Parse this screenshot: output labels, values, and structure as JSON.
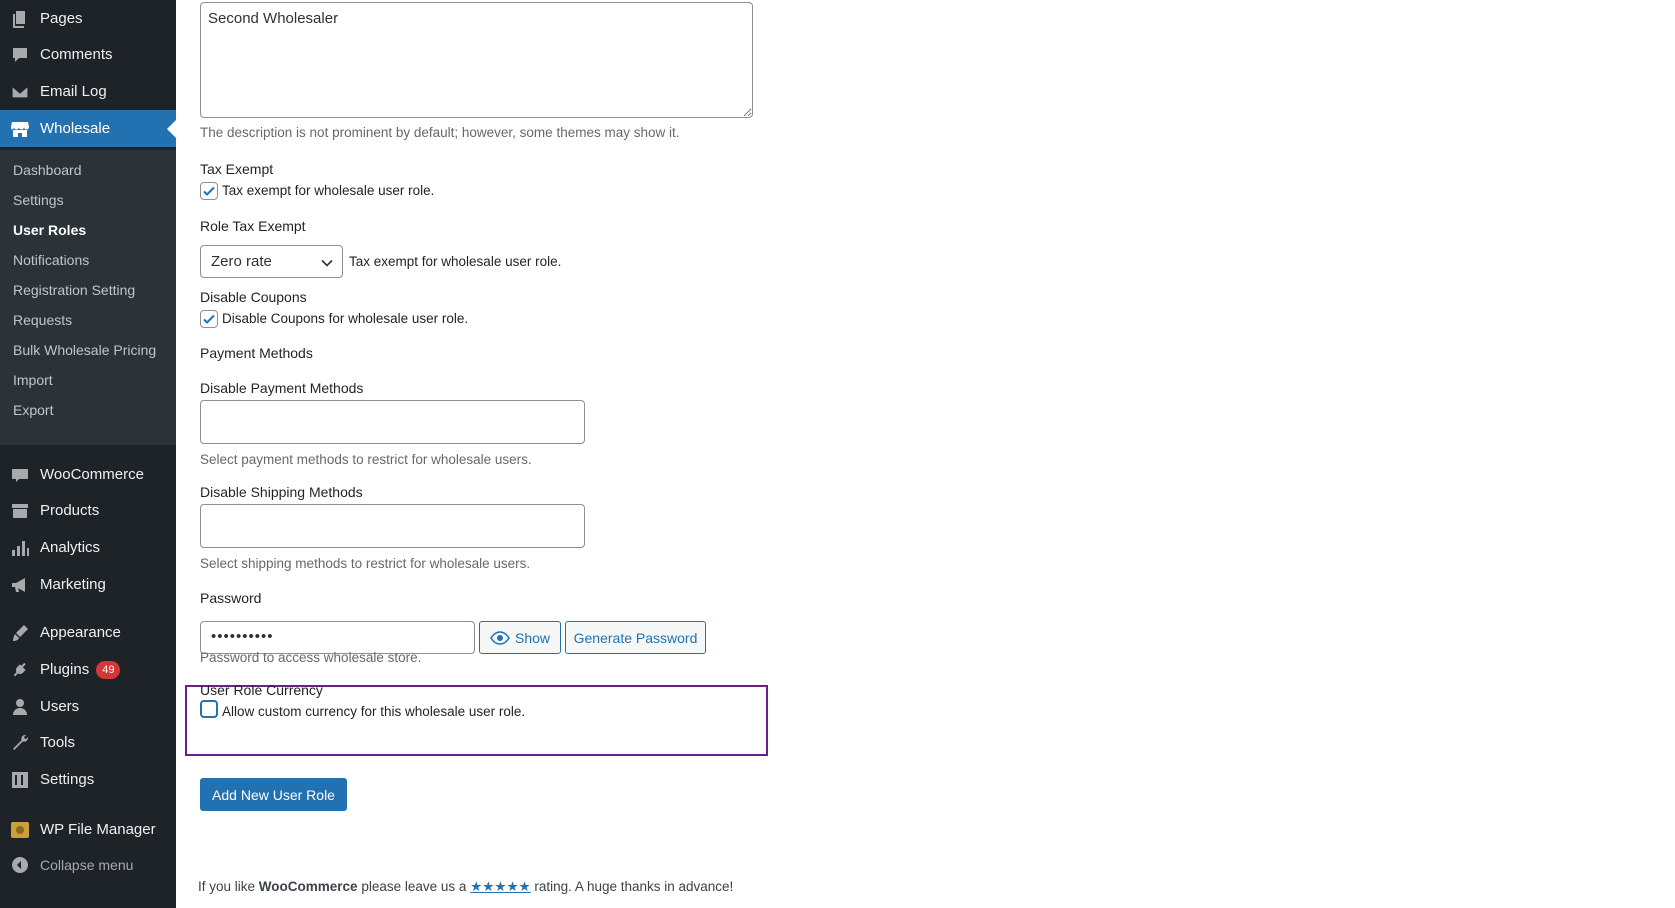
{
  "sidebar": {
    "top_items": [
      {
        "label": "Pages",
        "icon": "pages-icon"
      },
      {
        "label": "Comments",
        "icon": "comments-icon"
      },
      {
        "label": "Email Log",
        "icon": "email-icon"
      },
      {
        "label": "Wholesale",
        "icon": "store-icon"
      }
    ],
    "submenu": [
      "Dashboard",
      "Settings",
      "User Roles",
      "Notifications",
      "Registration Setting",
      "Requests",
      "Bulk Wholesale Pricing",
      "Import",
      "Export"
    ],
    "active_submenu": "User Roles",
    "bottom_items": [
      {
        "label": "WooCommerce",
        "icon": "woo-icon"
      },
      {
        "label": "Products",
        "icon": "products-icon"
      },
      {
        "label": "Analytics",
        "icon": "analytics-icon"
      },
      {
        "label": "Marketing",
        "icon": "marketing-icon"
      },
      {
        "label": "Appearance",
        "icon": "appearance-icon"
      },
      {
        "label": "Plugins",
        "icon": "plugins-icon",
        "badge": "49"
      },
      {
        "label": "Users",
        "icon": "users-icon"
      },
      {
        "label": "Tools",
        "icon": "tools-icon"
      },
      {
        "label": "Settings",
        "icon": "settings-icon"
      },
      {
        "label": "WP File Manager",
        "icon": "file-manager-icon"
      }
    ],
    "collapse_label": "Collapse menu"
  },
  "form": {
    "description_value": "Second Wholesaler",
    "description_help": "The description is not prominent by default; however, some themes may show it.",
    "tax_exempt": {
      "label": "Tax Exempt",
      "checkbox_label": "Tax exempt for wholesale user role.",
      "checked": true
    },
    "role_tax_exempt": {
      "label": "Role Tax Exempt",
      "selected": "Zero rate",
      "help": "Tax exempt for wholesale user role."
    },
    "disable_coupons": {
      "label": "Disable Coupons",
      "checkbox_label": "Disable Coupons for wholesale user role.",
      "checked": true
    },
    "payment_methods_heading": "Payment Methods",
    "disable_payment": {
      "label": "Disable Payment Methods",
      "help": "Select payment methods to restrict for wholesale users."
    },
    "disable_shipping": {
      "label": "Disable Shipping Methods",
      "help": "Select shipping methods to restrict for wholesale users."
    },
    "password": {
      "label": "Password",
      "value": "••••••••••",
      "show_label": "Show",
      "generate_label": "Generate Password",
      "help": "Password to access wholesale store."
    },
    "currency": {
      "label": "User Role Currency",
      "checkbox_label": "Allow custom currency for this wholesale user role.",
      "checked": false
    },
    "submit_label": "Add New User Role"
  },
  "footer": {
    "prefix": "If you like ",
    "brand": "WooCommerce",
    "middle": " please leave us a ",
    "stars": "★★★★★",
    "suffix": " rating. A huge thanks in advance!"
  },
  "colors": {
    "admin_blue": "#2271b1",
    "sidebar_bg": "#1d2327",
    "highlight": "#6b1f8f",
    "badge": "#d63638"
  }
}
